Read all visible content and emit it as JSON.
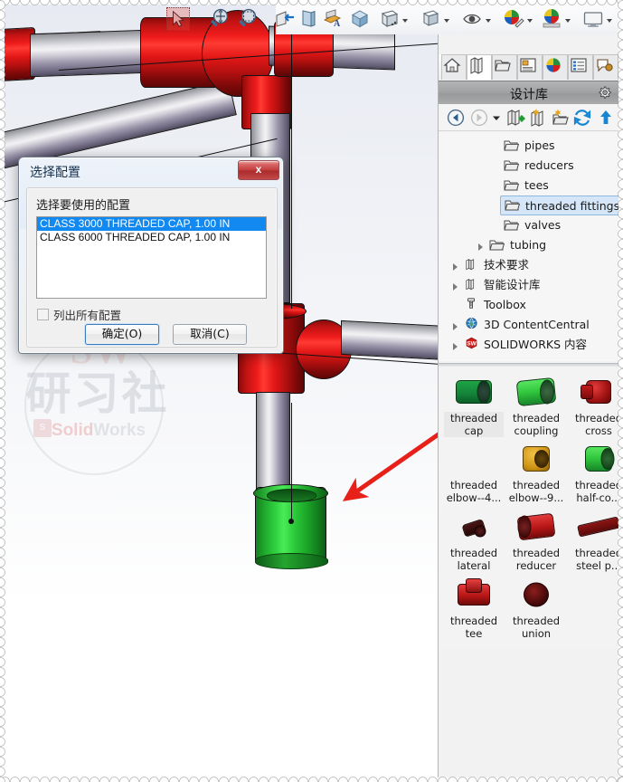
{
  "app": {
    "name": "SOLIDWORKS",
    "viewport_background": "#eef0f5"
  },
  "toolbar": {
    "items": [
      {
        "name": "select-tool",
        "label": "选择",
        "icon": "arrow-select-icon",
        "active": true
      },
      {
        "name": "zoom-to-fit",
        "label": "整屏显示全图",
        "icon": "zoom-fit-icon"
      },
      {
        "name": "zoom-to-area",
        "label": "局部放大",
        "icon": "zoom-area-icon"
      },
      {
        "name": "section-view",
        "label": "剖面视图",
        "icon": "section-view-icon"
      },
      {
        "name": "view-orientation",
        "label": "视图定向",
        "icon": "view-orientation-icon"
      },
      {
        "name": "display-style",
        "label": "显示样式",
        "icon": "display-style-icon",
        "has_caret": true
      },
      {
        "name": "hide-show-items",
        "label": "隐藏/显示项目",
        "icon": "eye-icon",
        "has_caret": true
      },
      {
        "name": "edit-appearance",
        "label": "编辑外观",
        "icon": "appearance-icon",
        "has_caret": true
      },
      {
        "name": "apply-scene",
        "label": "应用布景",
        "icon": "scene-icon",
        "has_caret": true
      },
      {
        "name": "view-settings",
        "label": "视图设定",
        "icon": "monitor-icon",
        "has_caret": true
      }
    ]
  },
  "dialog": {
    "title": "选择配置",
    "prompt": "选择要使用的配置",
    "close_label": "x",
    "close_icon": "close-icon",
    "configurations": [
      {
        "label": "CLASS 3000 THREADED CAP, 1.00 IN",
        "selected": true
      },
      {
        "label": "CLASS 6000 THREADED CAP, 1.00 IN",
        "selected": false
      }
    ],
    "checkbox": {
      "label": "列出所有配置",
      "checked": false
    },
    "ok_label": "确定(O)",
    "cancel_label": "取消(C)",
    "selection_color": "#1289f0"
  },
  "task_pane": {
    "tabs": [
      {
        "name": "home",
        "icon": "home-icon",
        "active": false
      },
      {
        "name": "design-library",
        "icon": "library-icon",
        "active": true
      },
      {
        "name": "file-explorer",
        "icon": "folder-icon",
        "active": false
      },
      {
        "name": "view-palette",
        "icon": "view-palette-icon",
        "active": false
      },
      {
        "name": "appearances-scenes",
        "icon": "appearances-sphere-icon",
        "active": false
      },
      {
        "name": "custom-properties",
        "icon": "properties-icon",
        "active": false
      },
      {
        "name": "solidworks-forum",
        "icon": "forum-icon",
        "active": false
      }
    ],
    "header": {
      "title": "设计库",
      "settings_icon": "gear-icon"
    },
    "toolbar": [
      {
        "name": "back",
        "icon": "back-arrow-icon"
      },
      {
        "name": "forward",
        "icon": "forward-arrow-icon",
        "disabled": true
      },
      {
        "name": "history-dropdown",
        "icon": "chevron-down-icon"
      },
      {
        "name": "add-to-library",
        "icon": "add-library-icon"
      },
      {
        "name": "new-library",
        "icon": "new-library-icon"
      },
      {
        "name": "new-folder",
        "icon": "new-folder-icon"
      },
      {
        "name": "refresh",
        "icon": "refresh-icon"
      },
      {
        "name": "up-one-level",
        "icon": "up-arrow-icon"
      }
    ],
    "tree": [
      {
        "label": "pipes",
        "icon": "folder-icon",
        "indent": 1,
        "expander": false,
        "selected": false
      },
      {
        "label": "reducers",
        "icon": "folder-icon",
        "indent": 1,
        "expander": false,
        "selected": false
      },
      {
        "label": "tees",
        "icon": "folder-icon",
        "indent": 1,
        "expander": false,
        "selected": false
      },
      {
        "label": "threaded fittings (",
        "icon": "folder-icon",
        "indent": 1,
        "expander": false,
        "selected": true
      },
      {
        "label": "valves",
        "icon": "folder-icon",
        "indent": 1,
        "expander": false,
        "selected": false
      },
      {
        "label": "tubing",
        "icon": "folder-icon",
        "indent": 0,
        "expander": true,
        "selected": false
      },
      {
        "label": "技术要求",
        "icon": "library-icon",
        "indent": 0,
        "expander": true,
        "selected": false
      },
      {
        "label": "智能设计库",
        "icon": "library-icon",
        "indent": 0,
        "expander": true,
        "selected": false
      },
      {
        "label": "Toolbox",
        "icon": "bolt-icon",
        "indent": 0,
        "expander": false,
        "selected": false
      },
      {
        "label": "3D ContentCentral",
        "icon": "globe-icon",
        "indent": 0,
        "expander": true,
        "selected": false
      },
      {
        "label": "SOLIDWORKS 内容",
        "icon": "sw-cube-icon",
        "indent": 0,
        "expander": true,
        "selected": false
      }
    ],
    "parts": [
      {
        "label": "threaded\ncap",
        "color": "#1a9a4a",
        "shape": "cap",
        "selected": true
      },
      {
        "label": "threaded\ncoupling",
        "color": "#3fcb44",
        "shape": "coupling",
        "selected": false
      },
      {
        "label": "threaded\ncross",
        "color": "#c41a1a",
        "shape": "cross",
        "selected": false
      },
      {
        "label": "threaded\nelbow--4...",
        "color": "#f5f5f5",
        "shape": "blank",
        "selected": false
      },
      {
        "label": "threaded\nelbow--9...",
        "color": "#d79b16",
        "shape": "elbow",
        "selected": false
      },
      {
        "label": "threaded\nhalf-co...",
        "color": "#39c93f",
        "shape": "halfcoupling",
        "selected": false
      },
      {
        "label": "threaded\nlateral",
        "color": "#3a1616",
        "shape": "lateral",
        "selected": false
      },
      {
        "label": "threaded\nreducer",
        "color": "#c21818",
        "shape": "reducer",
        "selected": false
      },
      {
        "label": "threaded\nsteel p...",
        "color": "#8b1414",
        "shape": "pipe",
        "selected": false
      },
      {
        "label": "threaded\ntee",
        "color": "#c41a1a",
        "shape": "tee",
        "selected": false
      },
      {
        "label": "threaded\nunion",
        "color": "#5a0f0f",
        "shape": "union",
        "selected": false
      }
    ]
  },
  "model": {
    "selected_component_color": "#33d445",
    "fitting_color": "#e21717",
    "pipe_color": "#b9b9c0",
    "annotation_arrow_color": "#e8201a",
    "annotation_arrow_name": "red-callout-arrow"
  },
  "watermark": {
    "initials": "SW",
    "chinese": "研习社",
    "brand_bold": "Solid",
    "brand_light": "Works",
    "cube_label": "S"
  }
}
